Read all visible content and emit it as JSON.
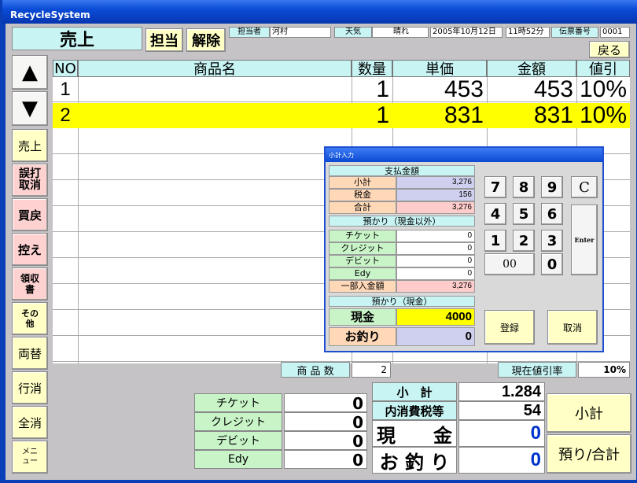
{
  "window": {
    "title": "RecycleSystem"
  },
  "top": {
    "mode_label": "売上",
    "tanto_button": "担当",
    "kaijo_button": "解除",
    "tantosha_label": "担当者",
    "tantosha_value": "河村",
    "tenki_label": "天気",
    "tenki_value": "晴れ",
    "date": "2005年10月12日",
    "time": "11時52分",
    "denpyo_label": "伝票番号",
    "denpyo_value": "0001",
    "back_button": "戻る"
  },
  "table": {
    "headers": {
      "no": "NO",
      "name": "商品名",
      "qty": "数量",
      "price": "単価",
      "amount": "金額",
      "discount": "値引"
    },
    "rows": [
      {
        "no": "1",
        "name": "",
        "qty": "1",
        "price": "453",
        "amount": "453",
        "discount": "10%"
      },
      {
        "no": "2",
        "name": "",
        "qty": "1",
        "price": "831",
        "amount": "831",
        "discount": "10%"
      }
    ]
  },
  "left_buttons": {
    "up": "▲",
    "down": "▼",
    "uriage": "売上",
    "gouchi": "誤打取消",
    "kaimodoshi": "買戻",
    "hikae": "控え",
    "ryoshusho": "領収書",
    "sonota": "その他",
    "ryogae": "両替",
    "gyokeshi": "行消",
    "zenkeshi": "全消",
    "menu": "メニュー"
  },
  "summary": {
    "item_count_label": "商 品 数",
    "item_count_value": "2",
    "discount_rate_label": "現在値引率",
    "discount_rate_value": "10%"
  },
  "bottom": {
    "ticket_label": "チケット",
    "ticket_value": "0",
    "credit_label": "クレジット",
    "credit_value": "0",
    "debit_label": "デビット",
    "debit_value": "0",
    "edy_label": "Edy",
    "edy_value": "0",
    "subtotal_label": "小　計",
    "subtotal_value": "1.284",
    "tax_label": "内消費税等",
    "tax_value": "54",
    "cash_label": "現　　金",
    "cash_value": "0",
    "change_label": "お 釣 り",
    "change_value": "0",
    "subtotal_button": "小計",
    "deposit_total_button": "預り/合計"
  },
  "dialog": {
    "title": "小計入力",
    "payment_header": "支払金額",
    "shokei_label": "小計",
    "shokei_value": "3,276",
    "zei_label": "税金",
    "zei_value": "156",
    "gokei_label": "合計",
    "gokei_value": "3,276",
    "deposit_noncash_header": "預かり（現金以外）",
    "ticket_label": "チケット",
    "ticket_value": "0",
    "credit_label": "クレジット",
    "credit_value": "0",
    "debit_label": "デビット",
    "debit_value": "0",
    "edy_label": "Edy",
    "edy_value": "0",
    "partial_label": "一部入金額",
    "partial_value": "3,276",
    "deposit_cash_header": "預かり（現金）",
    "cash_label": "現金",
    "cash_value": "4000",
    "change_label": "お釣り",
    "change_value": "0",
    "keys": [
      "7",
      "8",
      "9",
      "C",
      "4",
      "5",
      "6",
      "1",
      "2",
      "3",
      "00",
      "0"
    ],
    "enter_label": "Enter",
    "register_button": "登録",
    "cancel_button": "取消"
  }
}
